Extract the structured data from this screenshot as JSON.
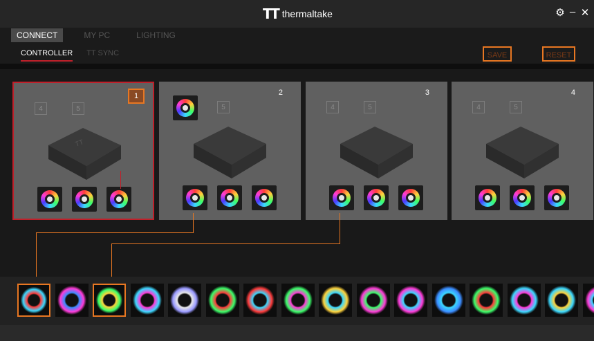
{
  "app": {
    "brand_mark": "TT",
    "brand_name": "thermaltake"
  },
  "window_controls": {
    "settings_icon": "gear-icon",
    "minimize_icon": "minimize-icon",
    "close_icon": "close-icon",
    "settings": "⚙",
    "minimize": "–",
    "close": "✕"
  },
  "nav": {
    "tabs": [
      {
        "label": "CONNECT",
        "active": true
      },
      {
        "label": "MY PC",
        "active": false
      },
      {
        "label": "LIGHTING",
        "active": false
      }
    ]
  },
  "subnav": {
    "tabs": [
      {
        "label": "CONTROLLER",
        "active": true
      },
      {
        "label": "TT SYNC",
        "active": false
      }
    ]
  },
  "actions": {
    "save": "SAVE",
    "reset": "RESET"
  },
  "colors": {
    "accent": "#e87722",
    "selected": "#c0202a"
  },
  "controllers": [
    {
      "number": "1",
      "selected": true,
      "slot4": "4",
      "slot5": "5"
    },
    {
      "number": "2",
      "selected": false,
      "slot4": "",
      "slot5": "5"
    },
    {
      "number": "3",
      "selected": false,
      "slot4": "4",
      "slot5": "5"
    },
    {
      "number": "4",
      "selected": false,
      "slot4": "4",
      "slot5": "5"
    }
  ],
  "devices": {
    "count_visible": 16
  }
}
